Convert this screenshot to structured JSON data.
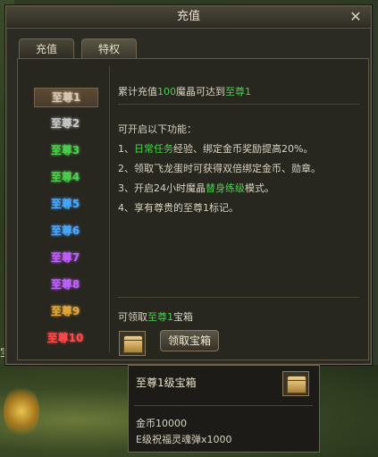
{
  "window": {
    "title": "充值",
    "close_glyph": "✕"
  },
  "tabs": [
    {
      "label": "充值",
      "active": false
    },
    {
      "label": "特权",
      "active": true
    }
  ],
  "tiers": [
    {
      "label": "至尊1",
      "color": "#d8c9b0",
      "selected": true
    },
    {
      "label": "至尊2",
      "color": "#c8c8c8",
      "selected": false
    },
    {
      "label": "至尊3",
      "color": "#4ed04e",
      "selected": false
    },
    {
      "label": "至尊4",
      "color": "#4ed04e",
      "selected": false
    },
    {
      "label": "至尊5",
      "color": "#4aa8ff",
      "selected": false
    },
    {
      "label": "至尊6",
      "color": "#4aa8ff",
      "selected": false
    },
    {
      "label": "至尊7",
      "color": "#c061ff",
      "selected": false
    },
    {
      "label": "至尊8",
      "color": "#c061ff",
      "selected": false
    },
    {
      "label": "至尊9",
      "color": "#e6a83a",
      "selected": false
    },
    {
      "label": "至尊10",
      "color": "#ff4a4a",
      "selected": false
    }
  ],
  "summary": {
    "prefix": "累计充值",
    "amount": "100",
    "middle": "魔晶可达到",
    "tier": "至尊1"
  },
  "features": {
    "heading": "可开启以下功能：",
    "item1": {
      "prefix": "1、",
      "highlight": "日常任务",
      "suffix": "经验、绑定金币奖励提高20%。"
    },
    "item2": "2、领取飞龙蛋时可获得双倍绑定金币、勋章。",
    "item3": {
      "prefix": "3、开启24小时魔晶",
      "highlight": "替身练级",
      "suffix": "模式。"
    },
    "item4": "4、享有尊贵的至尊1标记。"
  },
  "reward": {
    "prefix": "可领取",
    "tier": "至尊1",
    "suffix": "宝箱",
    "button": "领取宝箱"
  },
  "tooltip": {
    "title": "至尊1级宝箱",
    "gold": "金币10000",
    "item": "E级祝福灵魂弹x1000"
  },
  "background": {
    "partial_text": "宝"
  }
}
